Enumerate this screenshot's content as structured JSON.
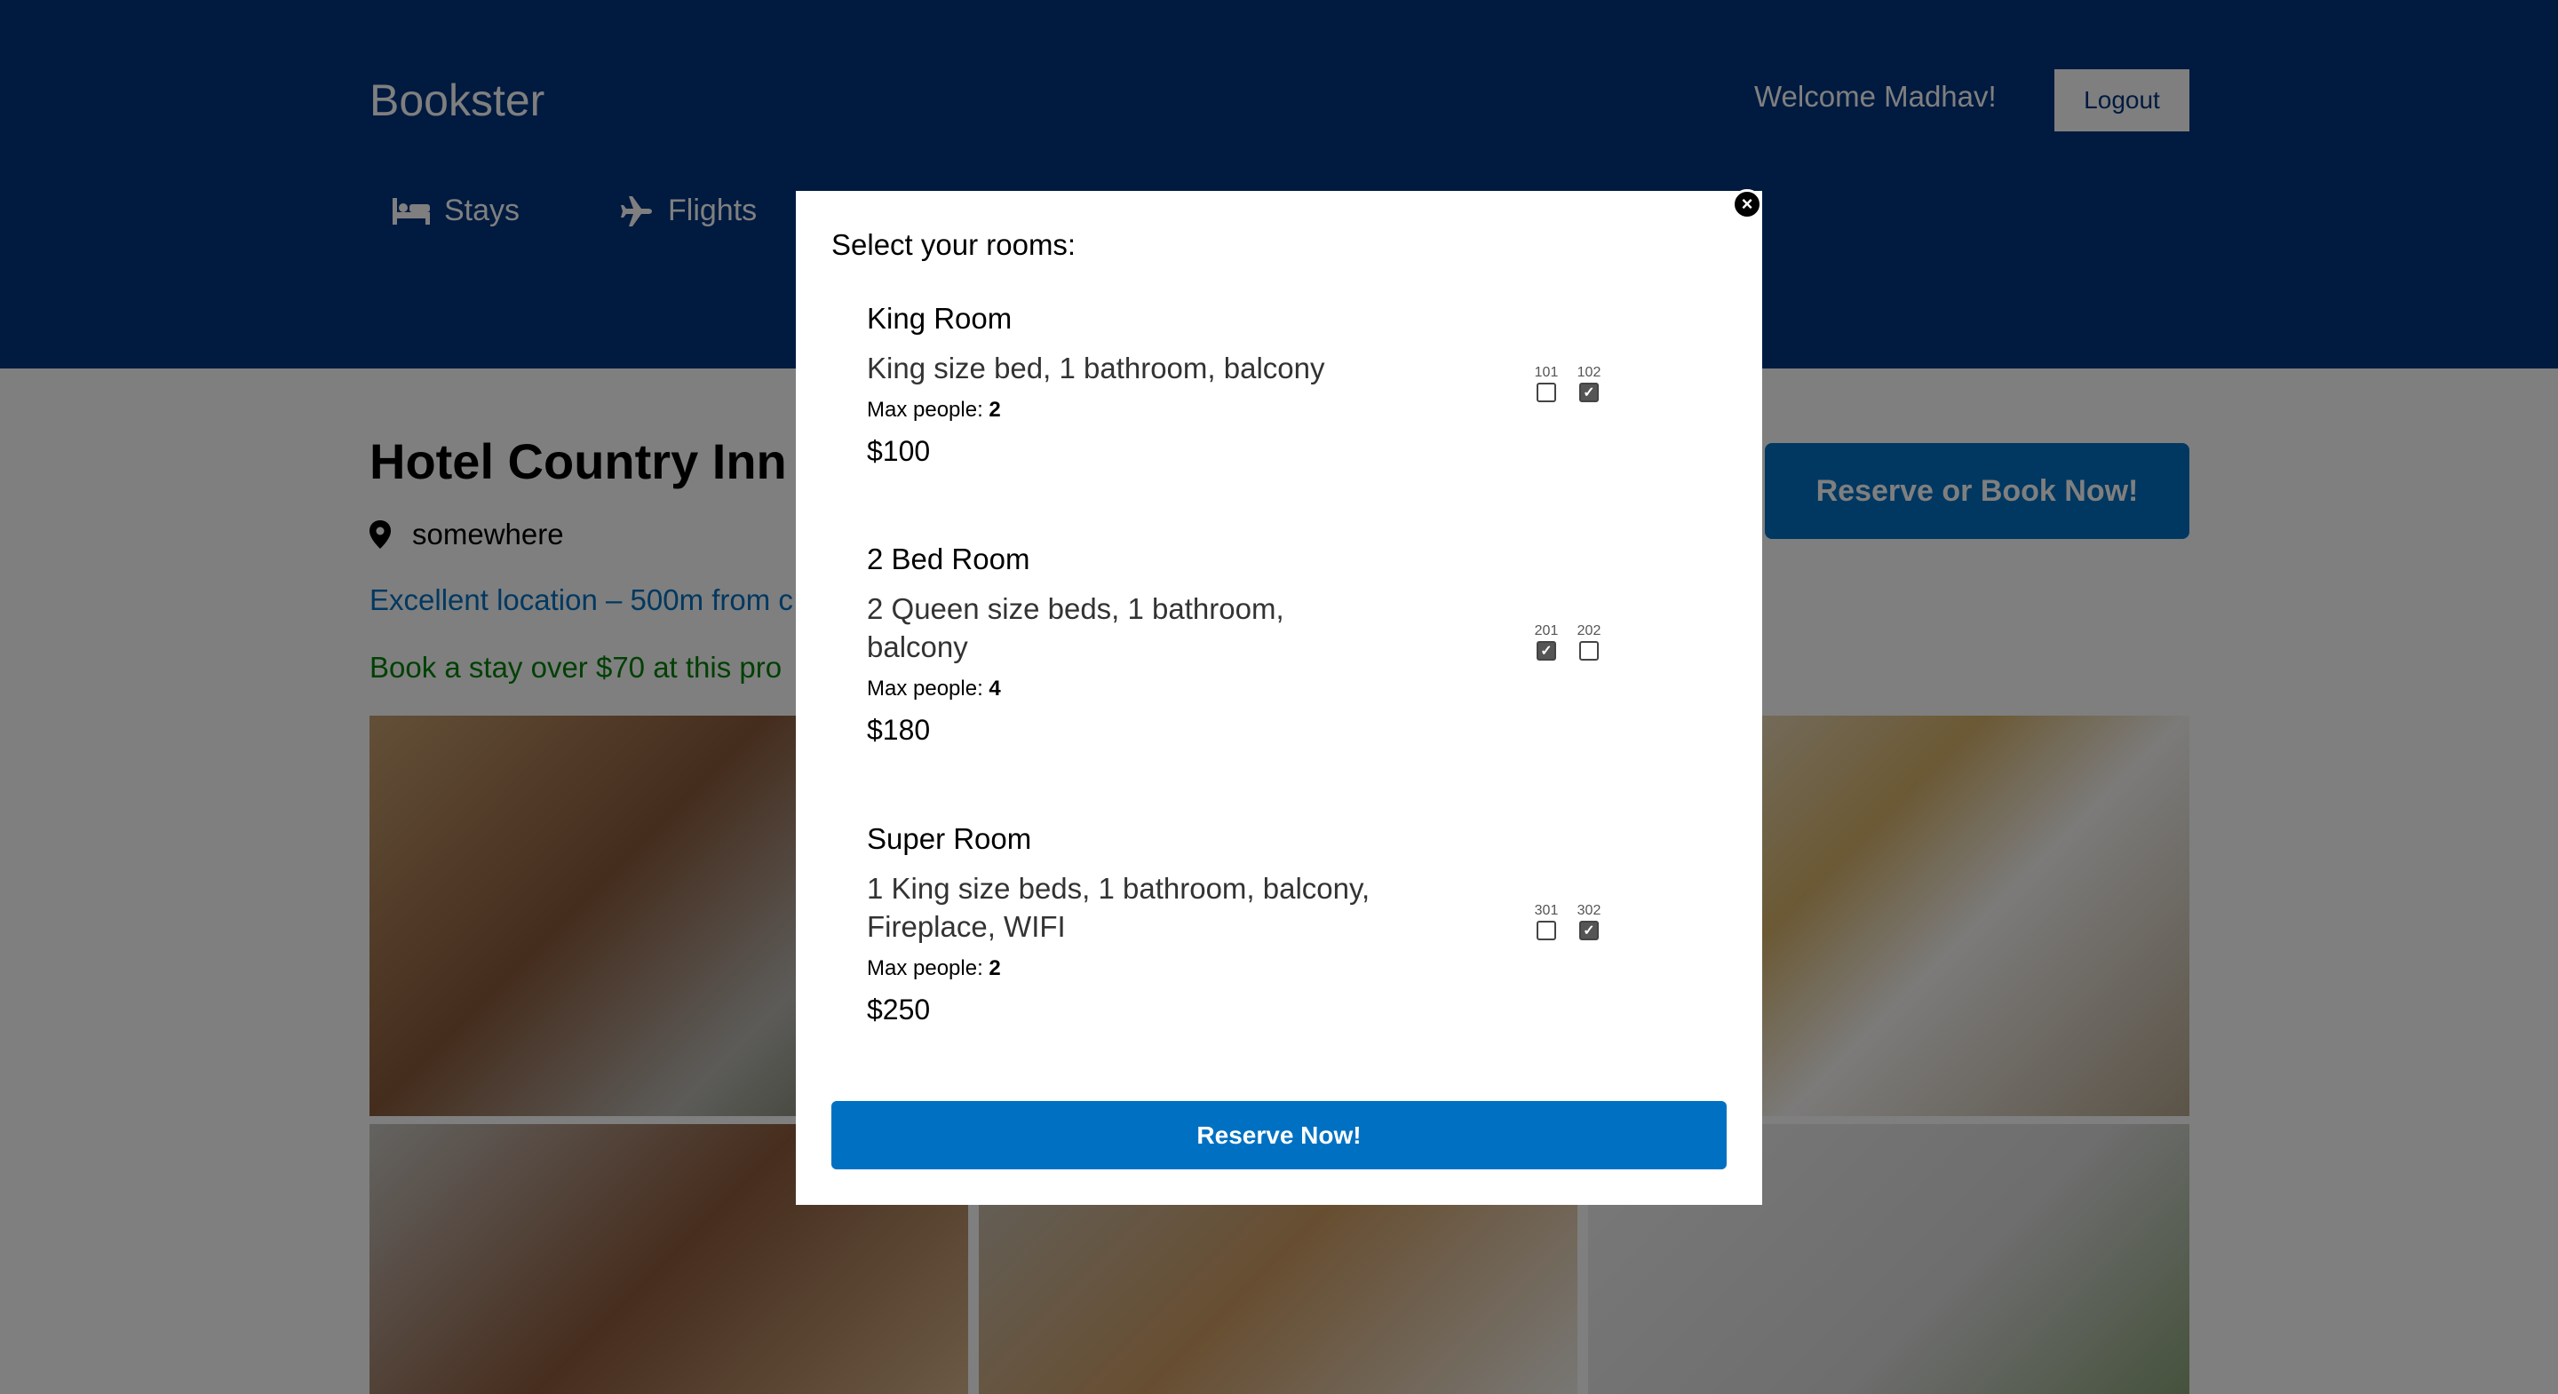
{
  "header": {
    "brand": "Bookster",
    "welcome": "Welcome Madhav!",
    "logout_label": "Logout",
    "nav": [
      {
        "label": "Stays",
        "icon": "bed-icon"
      },
      {
        "label": "Flights",
        "icon": "plane-icon"
      }
    ]
  },
  "hotel": {
    "title": "Hotel Country Inn",
    "address": "somewhere",
    "distance": "Excellent location – 500m from c",
    "highlight": "Book a stay over $70 at this pro",
    "book_button": "Reserve or Book Now!"
  },
  "modal": {
    "title": "Select your rooms:",
    "close_label": "×",
    "max_label": "Max people: ",
    "reserve_label": "Reserve Now!",
    "rooms": [
      {
        "title": "King Room",
        "desc": "King size bed, 1 bathroom, balcony",
        "max": "2",
        "price": "$100",
        "numbers": [
          {
            "num": "101",
            "checked": false
          },
          {
            "num": "102",
            "checked": true
          }
        ]
      },
      {
        "title": "2 Bed Room",
        "desc": "2 Queen size beds, 1 bathroom, balcony",
        "max": "4",
        "price": "$180",
        "numbers": [
          {
            "num": "201",
            "checked": true
          },
          {
            "num": "202",
            "checked": false
          }
        ]
      },
      {
        "title": "Super Room",
        "desc": "1 King size beds, 1 bathroom, balcony, Fireplace, WIFI",
        "max": "2",
        "price": "$250",
        "numbers": [
          {
            "num": "301",
            "checked": false
          },
          {
            "num": "302",
            "checked": true
          }
        ]
      }
    ]
  }
}
